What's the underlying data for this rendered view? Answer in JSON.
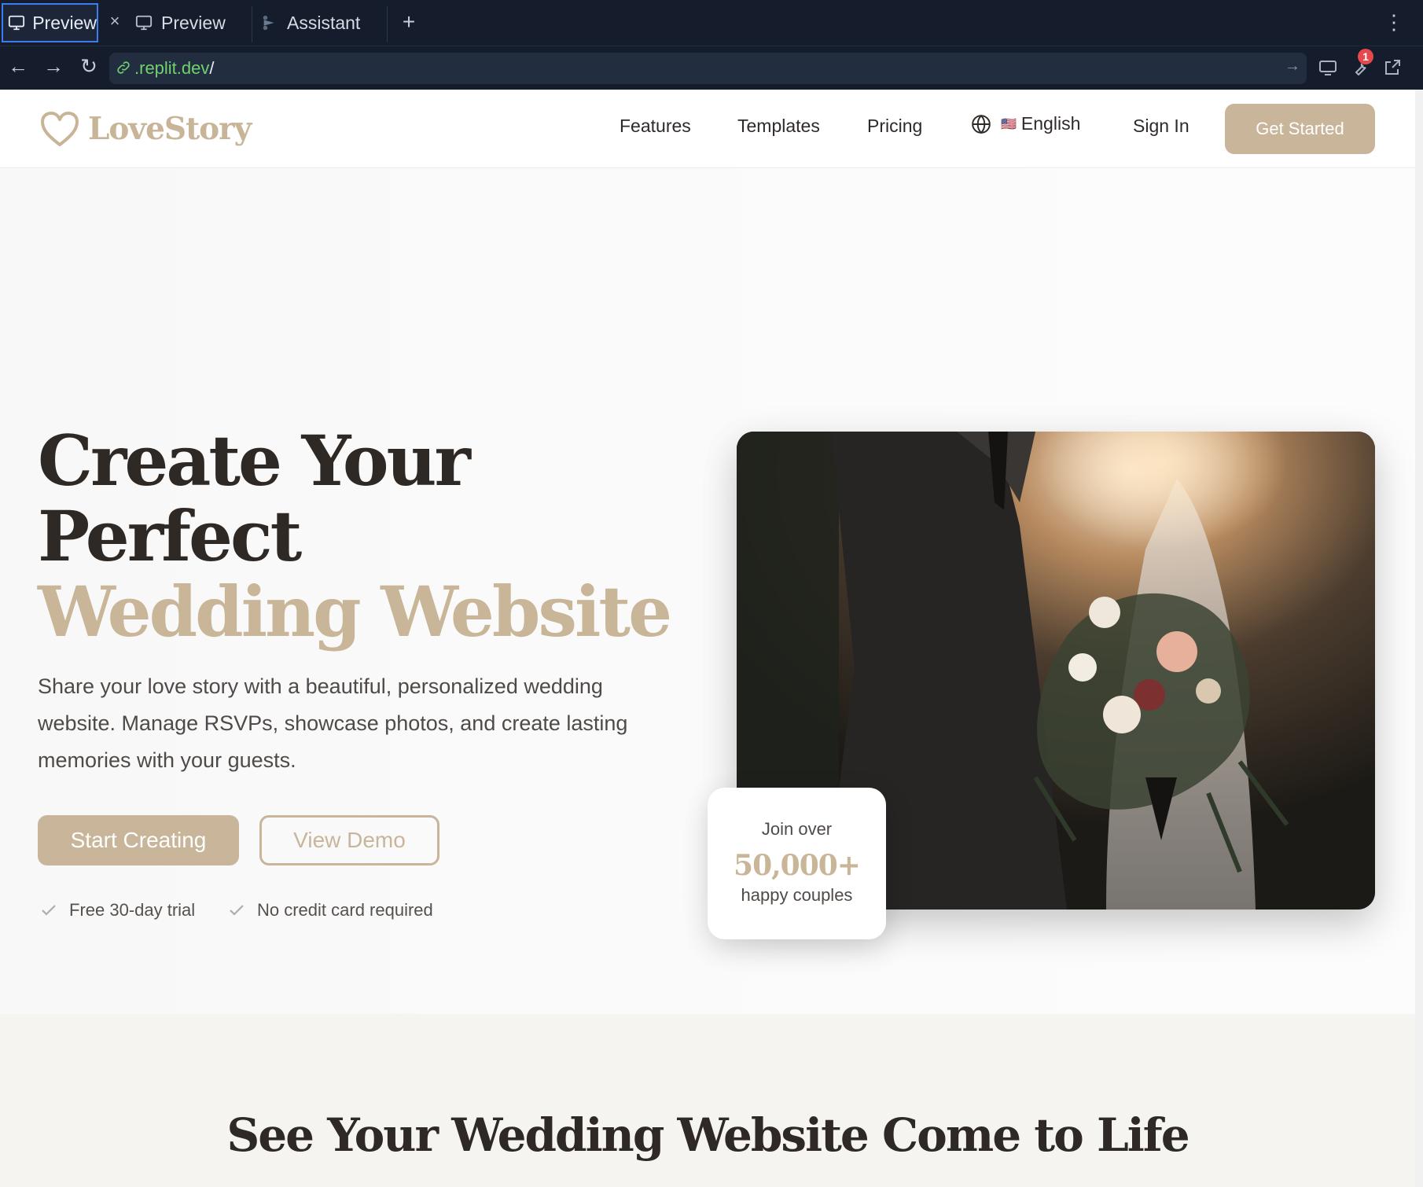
{
  "browser": {
    "tabs": [
      {
        "label": "Preview",
        "icon": "monitor-icon",
        "active": true
      },
      {
        "label": "Preview",
        "icon": "monitor-icon",
        "active": false
      },
      {
        "label": "Assistant",
        "icon": "assistant-icon",
        "active": false
      }
    ],
    "close_glyph": "×",
    "new_tab_glyph": "+",
    "menu_glyph": "⋮",
    "back_glyph": "←",
    "forward_glyph": "→",
    "reload_glyph": "↻",
    "url": {
      "domain": ".replit.dev",
      "path": "/"
    },
    "go_glyph": "→",
    "devtools_badge": "1",
    "colors": {
      "chrome": "#151d2d",
      "active_border": "#3c7cf0",
      "url_domain": "#6fd16f",
      "badge": "#e5484d"
    }
  },
  "site": {
    "logo": {
      "name": "LoveStory",
      "icon": "heart-icon"
    },
    "nav": [
      "Features",
      "Templates",
      "Pricing"
    ],
    "language": {
      "flag": "🇺🇸",
      "label": "English",
      "icon": "globe-icon"
    },
    "sign_in": "Sign In",
    "get_started": "Get Started",
    "colors": {
      "accent": "#c9b59a",
      "heading": "#2f2926",
      "body": "#4f4a47"
    }
  },
  "hero": {
    "title_line1": "Create Your",
    "title_line2": "Perfect",
    "title_accent": "Wedding Website",
    "lead": "Share your love story with a beautiful, personalized wedding website. Manage RSVPs, showcase photos, and create lasting memories with your guests.",
    "primary_cta": "Start Creating",
    "secondary_cta": "View Demo",
    "perks": [
      "Free 30-day trial",
      "No credit card required"
    ],
    "image": "wedding-couple-bouquet-photo",
    "stat": {
      "top": "Join over",
      "number": "50,000+",
      "bottom": "happy couples"
    }
  },
  "showcase": {
    "title": "See Your Wedding Website Come to Life"
  }
}
